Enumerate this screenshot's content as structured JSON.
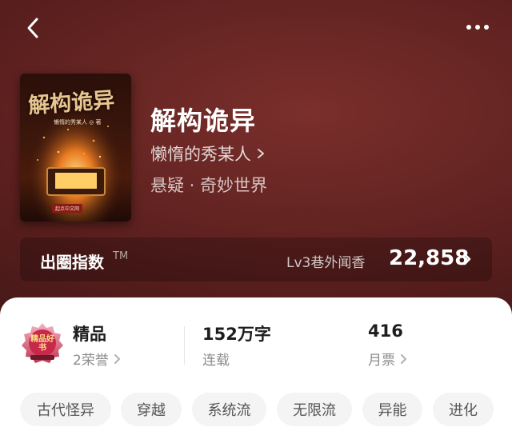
{
  "book": {
    "title": "解构诡异",
    "author": "懒惰的秀某人",
    "genre": "悬疑 · 奇妙世界",
    "cover_title": "解构诡异",
    "cover_author": "懒惰的秀某人 ◎ 著",
    "cover_publisher": "起点中文网"
  },
  "fame": {
    "label": "出圈指数",
    "tm": "TM",
    "level": "Lv3巷外闻香",
    "value": "22,858"
  },
  "stats": {
    "honor_title": "精品",
    "honor_sub": "2荣誉",
    "words_value": "152万字",
    "words_sub": "连载",
    "ticket_value": "416",
    "ticket_sub": "月票"
  },
  "badge_text": "精品好书",
  "tags": [
    "古代怪异",
    "穿越",
    "系统流",
    "无限流",
    "异能",
    "进化"
  ],
  "colors": {
    "hero": "#5a1f1e",
    "accent": "#b42a2a"
  },
  "icons": {
    "back": "back-icon",
    "more": "more-icon",
    "chevron": "chevron-right-icon"
  }
}
